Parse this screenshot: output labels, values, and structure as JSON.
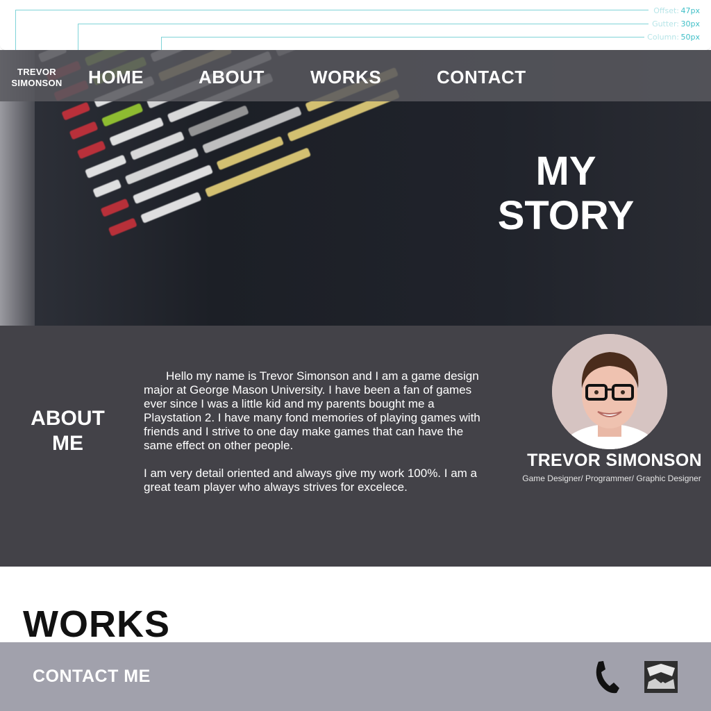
{
  "grid_spec": {
    "offset": {
      "label": "Offset:",
      "value": "47px"
    },
    "gutter": {
      "label": "Gutter:",
      "value": "30px"
    },
    "column": {
      "label": "Column:",
      "value": "50px"
    }
  },
  "brand": {
    "line1": "TREVOR",
    "line2": "SIMONSON"
  },
  "nav": [
    {
      "label": "HOME"
    },
    {
      "label": "ABOUT"
    },
    {
      "label": "WORKS"
    },
    {
      "label": "CONTACT"
    }
  ],
  "hero": {
    "line1": "MY",
    "line2": "STORY"
  },
  "about": {
    "title_line1": "ABOUT",
    "title_line2": "ME",
    "paragraph1": "Hello my name is Trevor Simonson and I am a game design major at George Mason University. I have been a fan of games ever since I was a little kid and my parents bought me a Playstation 2. I have many fond memories of playing games with friends and I strive to one day make games that can have the same effect on other people.",
    "paragraph2": "I am very detail oriented and always give my work 100%. I am a great team player who always strives for excelece.",
    "name": "TREVOR SIMONSON",
    "role": "Game Designer/ Programmer/ Graphic Designer"
  },
  "works": {
    "title": "WORKS"
  },
  "footer": {
    "contact_label": "CONTACT ME"
  },
  "icons": {
    "phone": "phone-icon",
    "logo": "logo-icon"
  },
  "colors": {
    "nav_bg": "#58585e",
    "about_bg": "#434248",
    "footer_bg": "#a1a1ac",
    "grid_accent": "#3fbfc7"
  }
}
